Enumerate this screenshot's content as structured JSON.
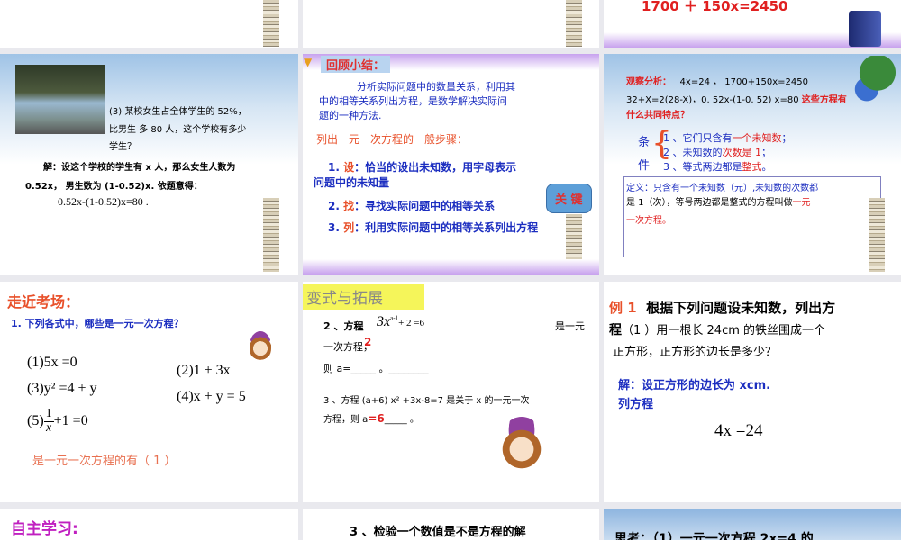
{
  "row1": {
    "s3_equation": "1700 ＋ 150x=2450"
  },
  "s4": {
    "q1": "(3)  某校女生占全体学生的 52%，",
    "q2": "比男生  多 80 人，这个学校有多少",
    "q3": "学生？",
    "a1": "解：设这个学校的学生有 x 人，那么女生人数为",
    "a2": "0.52x，   男生数为 (1-0.52)x. 依题意得：",
    "eq": "0.52x-(1-0.52)x=80 ."
  },
  "s5": {
    "title": "回顾小结：",
    "p1": "分析实际问题中的数量关系，利用其",
    "p2": "中的相等关系列出方程，是数学解决实际问",
    "p3": "题的一种方法.",
    "steps_title": "列出一元一次方程的一般步骤：",
    "st1n": "1. ",
    "st1k": "设",
    "st1t": "：恰当的设出未知数，用字母表示",
    "st1t2": "问题中的未知量",
    "st2n": "2. ",
    "st2k": "找",
    "st2t": "：寻找实际问题中的相等关系",
    "st3n": "3. ",
    "st3k": "列",
    "st3t": "：利用实际问题中的相等关系列出方程",
    "callout": "关 键"
  },
  "s6": {
    "l1a": "观察分析：",
    "l1b": "4x=24  ，  1700+150x=2450",
    "l2a": "32+X=2(28-X)，0. 52x-(1-0. 52) x=80",
    "l2b": "这些方程有",
    "l3": "什么共同特点？",
    "cond_a": "条",
    "cond_b": "件",
    "c1a": "1 、它们只含有",
    "c1b": "一个未知数",
    "c1c": "；",
    "c2a": "2 、未知数的",
    "c2b": "次数是 1",
    "c2c": "；",
    "c3a": "3 、等式两边都是",
    "c3b": "整式",
    "c3c": "。",
    "def1": "定义：只含有一个未知数（元）,未知数的次数都",
    "def2a": "是 1（次），等号两边都是整式的方程叫做",
    "def2b": "一元",
    "def3": "一次方程。"
  },
  "s7": {
    "title": "走近考场：",
    "q": "1. 下列各式中，哪些是一元一次方程？",
    "e1": "(1)5x =0",
    "e2": "(2)1 + 3x",
    "e3": "(3)y² =4 + y",
    "e4": "(4)x + y = 5",
    "e5a": "(5)",
    "e5n": "1",
    "e5d": "x",
    "e5b": "+1 =0",
    "ans": "是一元一次方程的有（ 1 ）"
  },
  "s8": {
    "title": "变式与拓展",
    "q2a": "2 、方程",
    "q2eq": "3x",
    "q2exp": "a-1",
    "q2eq2": "+ 2 =6",
    "q2b": "是一元",
    "q2c": "一次方程，",
    "q2ans": "2",
    "q2d": "则 a=_____ 。________",
    "q3a": "3 、方程 (a+6) x² +3x-8=7 是关于 x 的一元一次",
    "q3b": "方程，则 a",
    "q3ans": "=6",
    "q3c": "_____ 。"
  },
  "s9": {
    "ex": "例 1",
    "t1": "根据下列问题设未知数，列出方",
    "t2a": "程",
    "t2b": "（1 ）用一根长 24cm 的铁丝围成一个",
    "t3": "正方形，正方形的边长是多少？",
    "s1": "解：设正方形的边长为 xcm.",
    "s2": "列方程",
    "eq": "4x =24"
  },
  "row4": {
    "s10_title": "自主学习:",
    "s11_text": "3 、检验一个数值是不是方程的解",
    "s12_text": "思考：（1）一元一次方程 2x=4 的"
  }
}
